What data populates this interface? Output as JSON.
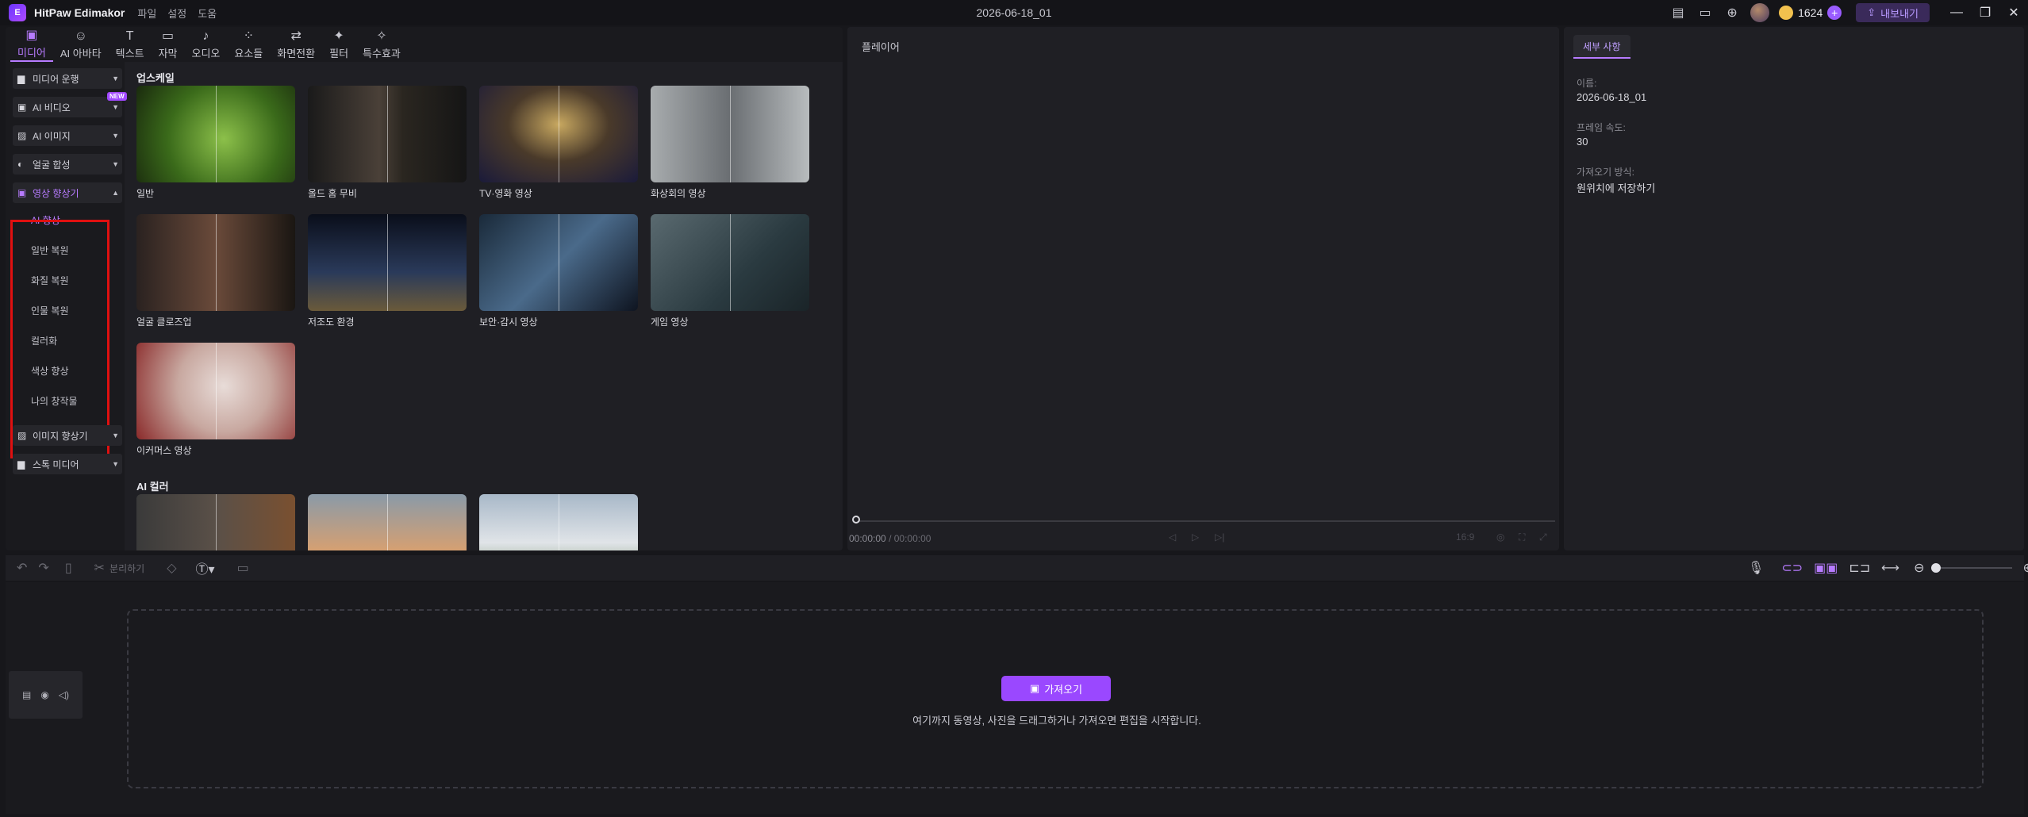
{
  "titlebar": {
    "app_name": "HitPaw Edimakor",
    "menus": [
      "파일",
      "설정",
      "도움"
    ],
    "document_title": "2026-06-18_01",
    "credits": "1624",
    "export_label": "내보내기"
  },
  "topnav": [
    {
      "label": "미디어",
      "icon": "media-icon"
    },
    {
      "label": "AI 아바타",
      "icon": "avatar-icon"
    },
    {
      "label": "텍스트",
      "icon": "text-icon"
    },
    {
      "label": "자막",
      "icon": "subtitle-icon"
    },
    {
      "label": "오디오",
      "icon": "audio-icon"
    },
    {
      "label": "요소들",
      "icon": "elements-icon"
    },
    {
      "label": "화면전환",
      "icon": "transition-icon"
    },
    {
      "label": "필터",
      "icon": "filter-icon"
    },
    {
      "label": "특수효과",
      "icon": "effects-icon"
    }
  ],
  "sidebar": {
    "items": [
      {
        "label": "미디어 운행"
      },
      {
        "label": "AI 비디오",
        "badge": "NEW"
      },
      {
        "label": "AI 이미지"
      },
      {
        "label": "얼굴 합성"
      },
      {
        "label": "영상 향상기"
      },
      {
        "label": "이미지 향상기"
      },
      {
        "label": "스톡 미디어"
      }
    ],
    "sub_items": [
      "AI 향상",
      "일반 복원",
      "화질 복원",
      "인물 복원",
      "컬러화",
      "색상 향상",
      "나의 창작물"
    ]
  },
  "content": {
    "section1": "업스케일",
    "cards": [
      "일반",
      "올드 홈 무비",
      "TV·영화 영상",
      "화상회의 영상",
      "얼굴 클로즈업",
      "저조도 환경",
      "보안·감시 영상",
      "게임 영상",
      "이커머스 영상"
    ],
    "section2": "AI 컬러"
  },
  "player": {
    "title": "플레이어",
    "time_current": "00:00:00",
    "time_total": "/ 00:00:00",
    "aspect": "16:9"
  },
  "details": {
    "tab": "세부 사항",
    "name_label": "이름:",
    "name_value": "2026-06-18_01",
    "fps_label": "프레임 속도:",
    "fps_value": "30",
    "import_label": "가져오기 방식:",
    "import_value": "원위치에 저장하기"
  },
  "timeline": {
    "split_label": "분리하기",
    "import_button": "가져오기",
    "drop_hint": "여기까지 동영상, 사진을 드래그하거나 가져오면 편집을 시작합니다."
  },
  "colors": {
    "accent": "#b77bff",
    "button": "#9a48ff",
    "highlight": "#e01010"
  }
}
